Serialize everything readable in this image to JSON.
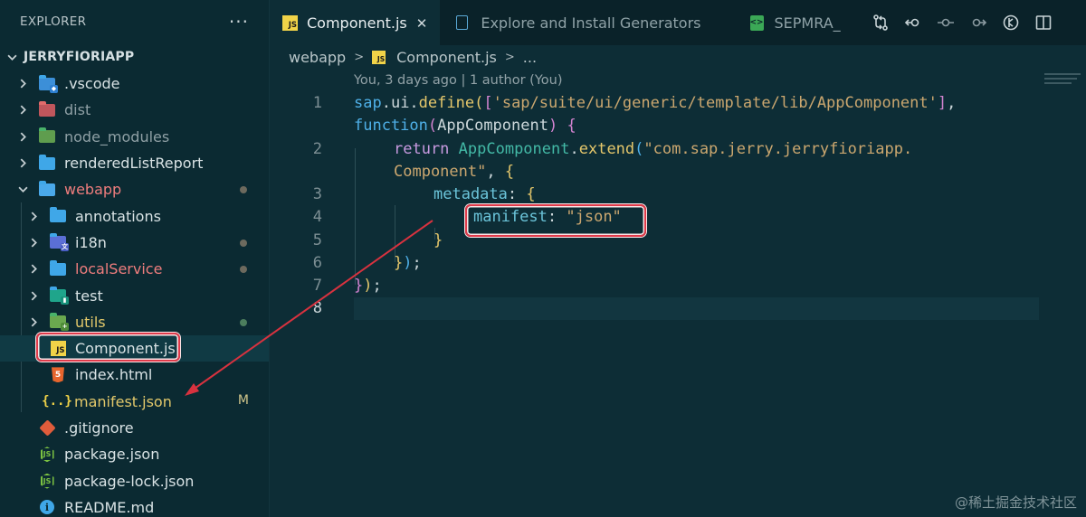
{
  "explorer": {
    "title": "EXPLORER",
    "more_label": "···",
    "root": "JERRYFIORIAPP",
    "items": [
      {
        "label": "vscode_dir",
        "text": ".vscode"
      },
      {
        "label": "dist_dir",
        "text": "dist"
      },
      {
        "label": "node_modules_dir",
        "text": "node_modules"
      },
      {
        "label": "renderedListReport_dir",
        "text": "renderedListReport"
      },
      {
        "label": "webapp_dir",
        "text": "webapp"
      },
      {
        "label": "annotations_dir",
        "text": "annotations"
      },
      {
        "label": "i18n_dir",
        "text": "i18n"
      },
      {
        "label": "localService_dir",
        "text": "localService"
      },
      {
        "label": "test_dir",
        "text": "test"
      },
      {
        "label": "utils_dir",
        "text": "utils"
      },
      {
        "label": "component_file",
        "text": "Component.js"
      },
      {
        "label": "index_file",
        "text": "index.html"
      },
      {
        "label": "manifest_file",
        "text": "manifest.json",
        "status": "M"
      },
      {
        "label": "gitignore_file",
        "text": ".gitignore"
      },
      {
        "label": "package_file",
        "text": "package.json"
      },
      {
        "label": "package_lock_file",
        "text": "package-lock.json"
      },
      {
        "label": "readme_file",
        "text": "README.md"
      }
    ]
  },
  "tabs": {
    "active": "Component.js",
    "close_glyph": "✕",
    "second": "Explore and Install Generators",
    "third": "SEPMRA_",
    "icon_js": "JS",
    "icon_third": "<>"
  },
  "toolbar_icons": [
    "git-compare-icon",
    "go-back-icon",
    "commit-icon",
    "go-forward-icon",
    "timeline-icon",
    "split-editor-icon"
  ],
  "breadcrumb": {
    "folder": "webapp",
    "file": "Component.js",
    "ellipsis": "..."
  },
  "blame": "You, 3 days ago | 1 author (You)",
  "code": {
    "line_numbers": [
      "1",
      "2",
      "3",
      "4",
      "5",
      "6",
      "7",
      "8"
    ],
    "l1a_sap": "sap",
    "l1a_ui": ".ui.",
    "l1a_define": "define",
    "l1a_paren": "(",
    "l1a_bracket_open": "[",
    "l1a_str": "'sap/suite/ui/generic/template/lib/AppComponent'",
    "l1a_bracket_close": "]",
    "l1a_comma": ",",
    "l1b_function": "function",
    "l1b_paren_open": "(",
    "l1b_param": "AppComponent",
    "l1b_paren_close": ")",
    "l1b_brace": " {",
    "l2a_return": "return ",
    "l2a_obj": "AppComponent",
    "l2a_dot": ".",
    "l2a_extend": "extend",
    "l2a_paren": "(",
    "l2a_str": "\"com.sap.jerry.jerryfioriapp.",
    "l2b_str": "Component\"",
    "l2b_rest": ", ",
    "l2b_brace": "{",
    "l3_key": "metadata",
    "l3_colon": ": ",
    "l3_brace": "{",
    "l4_key": "manifest",
    "l4_colon": ": ",
    "l4_val": "\"json\"",
    "l5_brace": "}",
    "l6_brace": "}",
    "l6_paren": ")",
    "l6_semi": ";",
    "l7_brace": "}",
    "l7_paren": ")",
    "l7_semi": ";"
  },
  "watermark": "@稀土掘金技术社区",
  "colors": {
    "highlight_border": "#e03a4a",
    "arrow": "#d8323f",
    "js_icon": "#f1d348",
    "folder_blue": "#3fa7e8"
  }
}
